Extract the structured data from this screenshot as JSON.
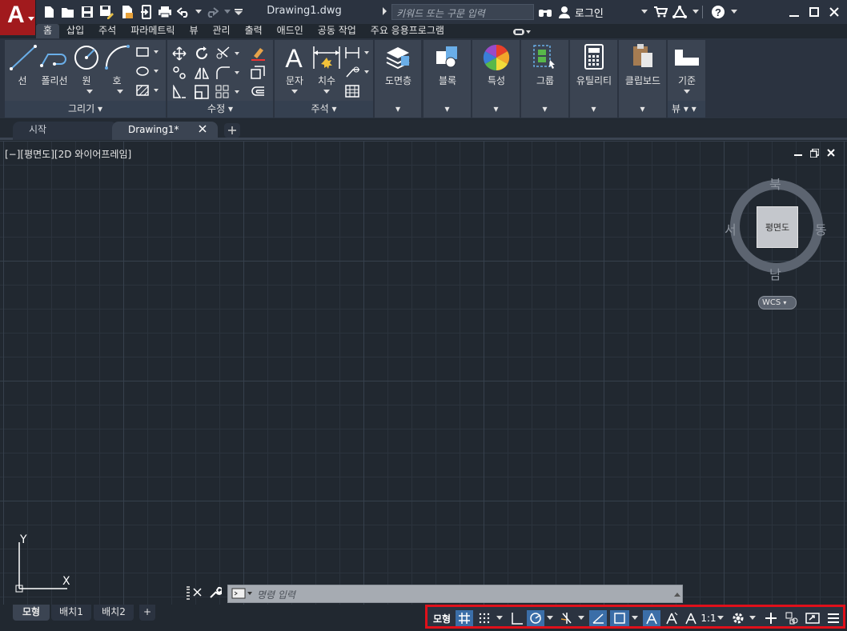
{
  "app": {
    "logo_letter": "A",
    "document_title": "Drawing1.dwg"
  },
  "search": {
    "placeholder": "키워드 또는 구문 입력"
  },
  "account": {
    "login_label": "로그인"
  },
  "ribbon_tabs": [
    "홈",
    "삽입",
    "주석",
    "파라메트릭",
    "뷰",
    "관리",
    "출력",
    "애드인",
    "공동 작업",
    "주요 응용프로그램"
  ],
  "ribbon": {
    "draw": {
      "panel_title": "그리기",
      "line": "선",
      "polyline": "폴리선",
      "circle": "원",
      "arc": "호"
    },
    "modify": {
      "panel_title": "수정"
    },
    "annotation": {
      "panel_title": "주석",
      "text": "문자",
      "dimension": "치수"
    },
    "layers": {
      "label": "도면층"
    },
    "block": {
      "label": "블록"
    },
    "properties": {
      "label": "특성"
    },
    "groups": {
      "label": "그룹"
    },
    "utilities": {
      "label": "유틸리티"
    },
    "clipboard": {
      "label": "클립보드"
    },
    "view": {
      "label": "기준",
      "panel_title": "뷰"
    }
  },
  "doc_tabs": {
    "start": "시작",
    "drawing": "Drawing1*"
  },
  "viewport": {
    "label": "[−][평면도][2D 와이어프레임]"
  },
  "viewcube": {
    "north": "북",
    "south": "남",
    "east": "동",
    "west": "서",
    "face": "평면도",
    "wcs": "WCS"
  },
  "ucs": {
    "x": "X",
    "y": "Y"
  },
  "command": {
    "placeholder": "명령 입력"
  },
  "layout_tabs": [
    "모형",
    "배치1",
    "배치2"
  ],
  "status": {
    "model_label": "모형",
    "scale_label": "1:1"
  },
  "colors": {
    "accent": "#3b6ea8",
    "highlight_border": "#e0101a",
    "logo": "#a11a1d"
  }
}
